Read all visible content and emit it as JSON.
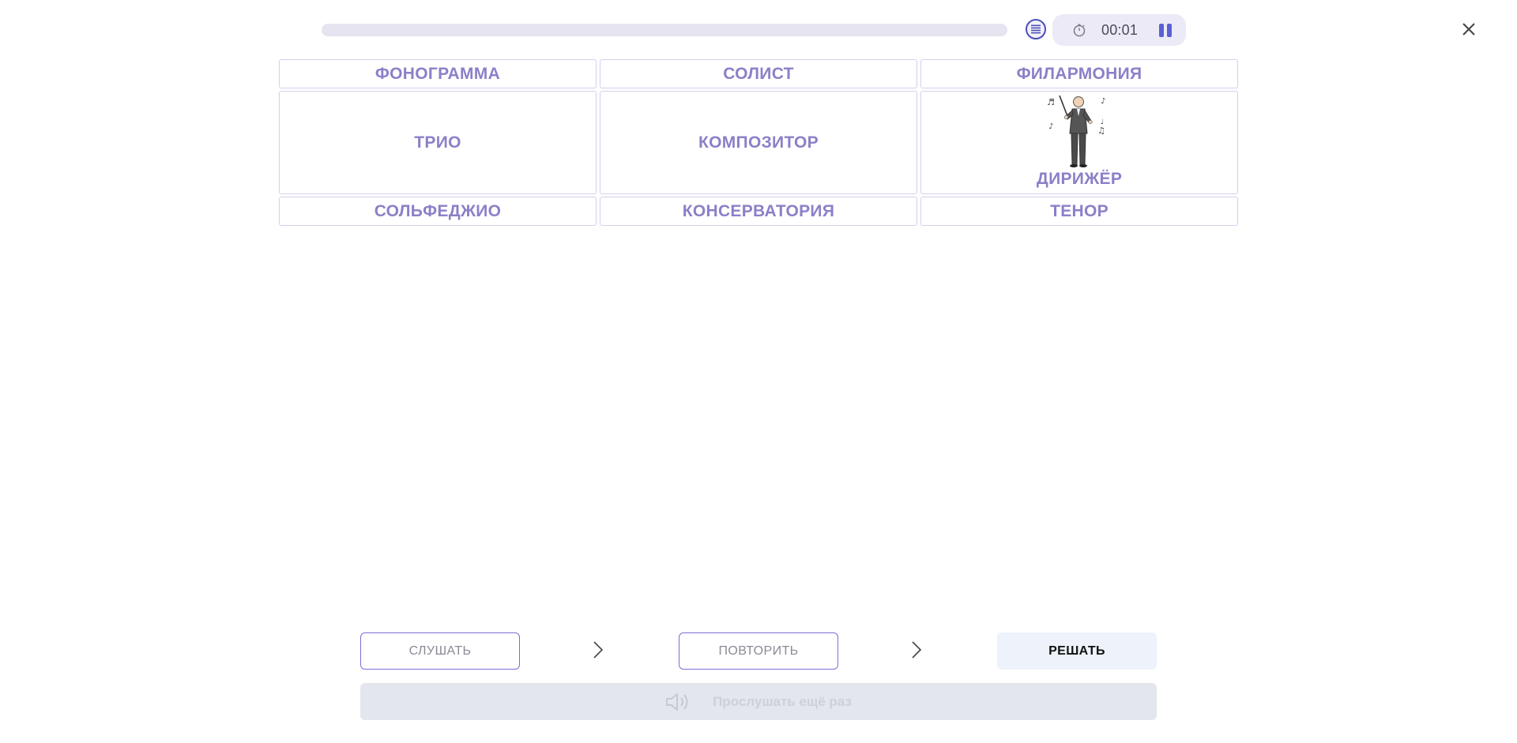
{
  "progress": {
    "fraction": 0
  },
  "timer": {
    "time": "00:01"
  },
  "icons": {
    "list": "list-icon",
    "timer": "stopwatch-icon",
    "pause": "pause-icon",
    "close": "close-icon",
    "chevron": "chevron-right-icon",
    "speaker": "speaker-icon"
  },
  "grid": {
    "row1": [
      "ФОНОГРАММА",
      "СОЛИСТ",
      "ФИЛАРМОНИЯ"
    ],
    "row2": [
      "ТРИО",
      "КОМПОЗИТОР",
      "ДИРИЖЁР"
    ],
    "row3": [
      "СОЛЬФЕДЖИО",
      "КОНСЕРВАТОРИЯ",
      "ТЕНОР"
    ]
  },
  "controls": {
    "listen": "СЛУШАТЬ",
    "repeat": "ПОВТОРИТЬ",
    "solve": "РЕШАТЬ",
    "listen_again": "Прослушать ещё раз"
  },
  "colors": {
    "word": "#8b80c8",
    "accent": "#5b5fd6",
    "cell_border": "#d3d0ec"
  }
}
